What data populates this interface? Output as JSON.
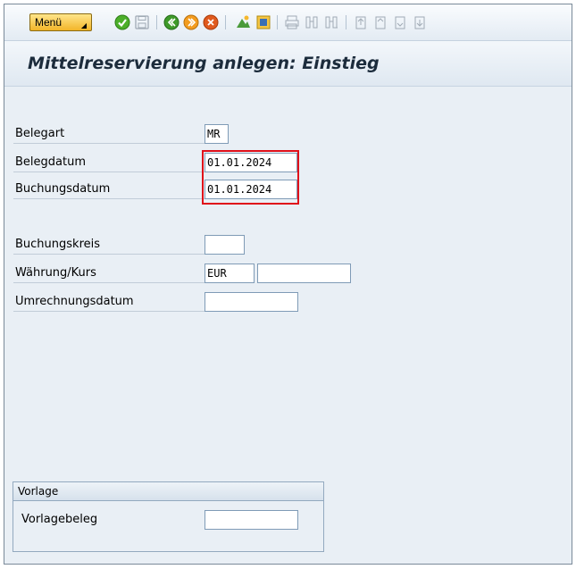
{
  "toolbar": {
    "menu_label": "Menü",
    "icons": [
      "check-icon",
      "save-icon",
      "back-icon",
      "exit-icon",
      "cancel-icon",
      "create-session-icon",
      "shortcut-icon",
      "print-icon",
      "find-icon",
      "find-next-icon",
      "first-page-icon",
      "previous-page-icon",
      "next-page-icon",
      "last-page-icon"
    ]
  },
  "title": "Mittelreservierung anlegen: Einstieg",
  "fields": {
    "belegart": {
      "label": "Belegart",
      "value": "MR"
    },
    "belegdatum": {
      "label": "Belegdatum",
      "value": "01.01.2024"
    },
    "buchungsdatum": {
      "label": "Buchungsdatum",
      "value": "01.01.2024"
    },
    "buchungskreis": {
      "label": "Buchungskreis",
      "value": ""
    },
    "waehrung": {
      "label": "Währung/Kurs",
      "value": "EUR",
      "kurs": ""
    },
    "umrechnungsdatum": {
      "label": "Umrechnungsdatum",
      "value": ""
    }
  },
  "vorlage": {
    "title": "Vorlage",
    "field_label": "Vorlagebeleg",
    "value": ""
  },
  "colors": {
    "highlight": "#e0101a",
    "menu_button": "#f2b529"
  }
}
